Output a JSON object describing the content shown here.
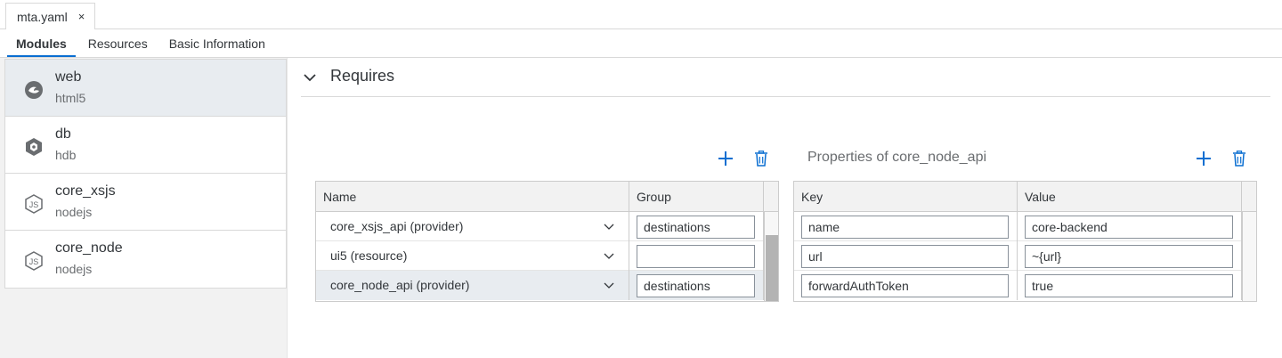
{
  "editor_tab": {
    "filename": "mta.yaml",
    "close_glyph": "×"
  },
  "subtabs": [
    {
      "label": "Modules",
      "active": true
    },
    {
      "label": "Resources",
      "active": false
    },
    {
      "label": "Basic Information",
      "active": false
    }
  ],
  "modules": [
    {
      "name": "web",
      "type": "html5",
      "icon": "html5-icon",
      "selected": true
    },
    {
      "name": "db",
      "type": "hdb",
      "icon": "hdb-icon",
      "selected": false
    },
    {
      "name": "core_xsjs",
      "type": "nodejs",
      "icon": "nodejs-icon",
      "selected": false
    },
    {
      "name": "core_node",
      "type": "nodejs",
      "icon": "nodejs-icon",
      "selected": false
    }
  ],
  "requires": {
    "title": "Requires",
    "columns": {
      "name": "Name",
      "group": "Group"
    },
    "rows": [
      {
        "name": "core_xsjs_api (provider)",
        "group": "destinations",
        "selected": false
      },
      {
        "name": "ui5 (resource)",
        "group": "",
        "selected": false
      },
      {
        "name": "core_node_api (provider)",
        "group": "destinations",
        "selected": true
      }
    ]
  },
  "properties": {
    "title": "Properties of core_node_api",
    "columns": {
      "key": "Key",
      "value": "Value"
    },
    "rows": [
      {
        "key": "name",
        "value": "core-backend"
      },
      {
        "key": "url",
        "value": "~{url}"
      },
      {
        "key": "forwardAuthToken",
        "value": "true"
      }
    ]
  },
  "colors": {
    "accent": "#0a6ed1",
    "text": "#32363a",
    "selected_row": "#e8ecf0",
    "sidebar_bg": "#f2f2f2"
  }
}
